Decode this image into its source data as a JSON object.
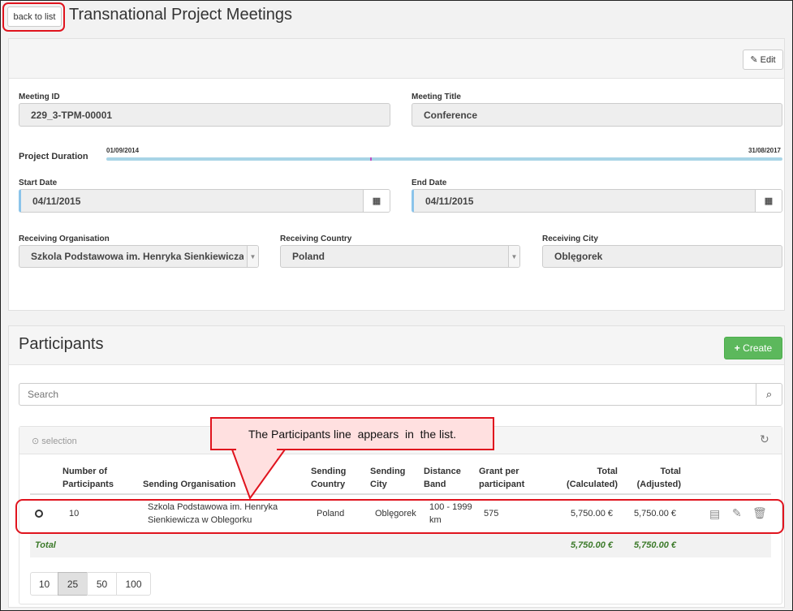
{
  "header": {
    "back_label": "back to list",
    "title": "Transnational Project Meetings"
  },
  "meeting": {
    "edit_label": "Edit",
    "meeting_id_label": "Meeting ID",
    "meeting_id": "229_3-TPM-00001",
    "meeting_title_label": "Meeting Title",
    "meeting_title": "Conference",
    "duration_label": "Project Duration",
    "duration_start": "01/09/2014",
    "duration_end": "31/08/2017",
    "start_label": "Start Date",
    "start_date": "04/11/2015",
    "end_label": "End Date",
    "end_date": "04/11/2015",
    "org_label": "Receiving Organisation",
    "org": "Szkola Podstawowa im. Henryka Sienkiewicza w Oblegorku",
    "country_label": "Receiving Country",
    "country": "Poland",
    "city_label": "Receiving City",
    "city": "Oblęgorek"
  },
  "participants": {
    "title": "Participants",
    "create_label": "Create",
    "search_placeholder": "Search",
    "selection_label": "selection",
    "columns": [
      "Number of Participants",
      "Sending Organisation",
      "Sending Country",
      "Sending City",
      "Distance Band",
      "Grant per participant",
      "Total (Calculated)",
      "Total (Adjusted)"
    ],
    "rows": [
      {
        "number": "10",
        "org": "Szkola Podstawowa im. Henryka Sienkiewicza w Oblegorku",
        "country": "Poland",
        "city": "Oblęgorek",
        "band": "100 - 1999 km",
        "grant": "575",
        "total_calc": "5,750.00 €",
        "total_adj": "5,750.00 €"
      }
    ],
    "total_label": "Total",
    "total_calc": "5,750.00 €",
    "total_adj": "5,750.00 €",
    "page_sizes": [
      "10",
      "25",
      "50",
      "100"
    ],
    "selected_page_size": "25"
  },
  "annotation": {
    "callout": "The Participants line  appears  in  the list."
  },
  "colors": {
    "accent_green": "#5cb85c",
    "annotation_red": "#e0141e",
    "callout_fill": "#ffe0e0",
    "timeline": "#a8d4e6"
  }
}
